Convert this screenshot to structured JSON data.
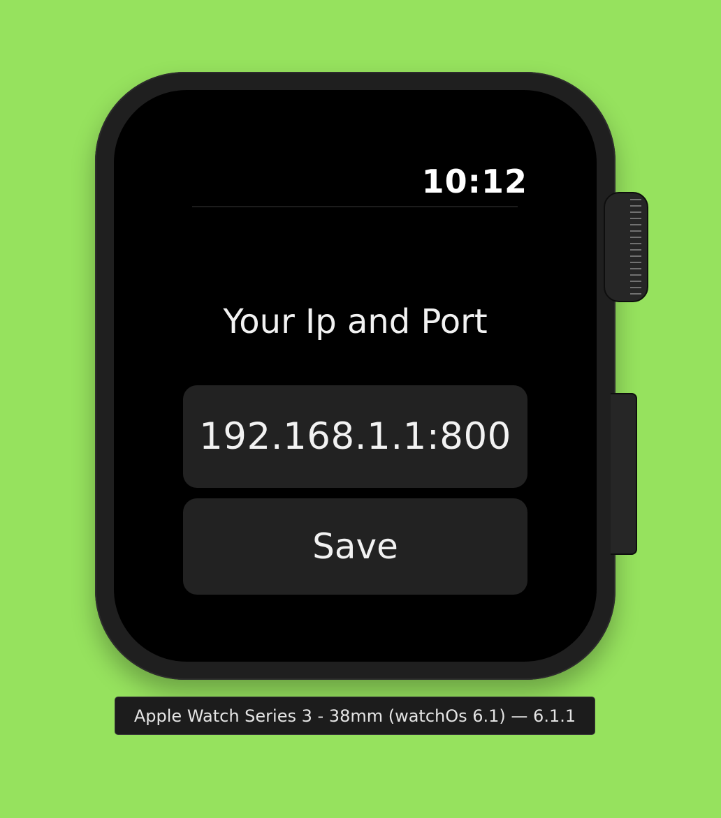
{
  "device": {
    "label": "Apple Watch Series 3 - 38mm (watchOs 6.1) — 6.1.1"
  },
  "status_bar": {
    "time": "10:12"
  },
  "main": {
    "heading": "Your Ip and Port",
    "ip_field_value": "192.168.1.1:800",
    "save_label": "Save"
  },
  "colors": {
    "background": "#96e25e",
    "watch_frame": "#1f1f1f",
    "screen": "#000000",
    "control": "#222222",
    "text": "#f2f2f2"
  }
}
